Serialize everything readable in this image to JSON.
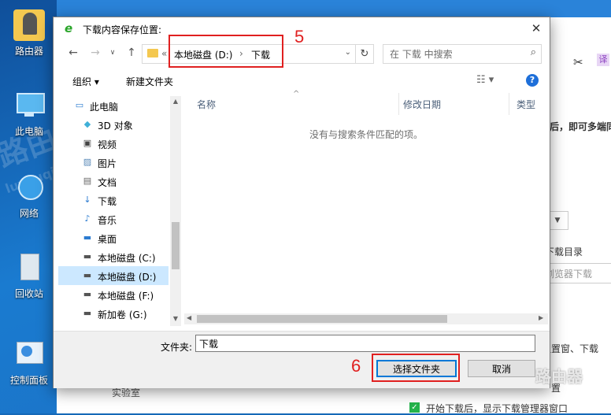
{
  "desktop": {
    "icons": [
      {
        "label": "路由器",
        "icon": "router-folder-icon"
      },
      {
        "label": "此电脑",
        "icon": "computer-icon"
      },
      {
        "label": "网络",
        "icon": "network-icon"
      },
      {
        "label": "回收站",
        "icon": "recycle-bin-icon"
      },
      {
        "label": "控制面板",
        "icon": "control-panel-icon"
      }
    ],
    "watermark_text": "路由器",
    "watermark_sub": "luyouqi.com"
  },
  "background_app": {
    "text_fragments": [
      "后，即可多端同",
      "下载目录",
      "浏览器下载",
      "位置窗、下载",
      "置",
      "开始下载后，显示下载管理器窗口",
      "实验室"
    ],
    "icons": [
      "scissors-icon",
      "translate-icon",
      "checkbox-checked-icon",
      "flask-icon"
    ]
  },
  "dialog": {
    "title": "下载内容保存位置:",
    "title_icon": "browser-e-icon",
    "address": {
      "prefix": "«",
      "segments": [
        "本地磁盘 (D:)",
        "下载"
      ],
      "separator": "›"
    },
    "search_placeholder": "在 下载 中搜索",
    "toolbar": {
      "organize_label": "组织 ▾",
      "new_folder_label": "新建文件夹"
    },
    "tree": [
      {
        "label": "此电脑",
        "icon": "computer-icon",
        "indent": 0,
        "selected": false
      },
      {
        "label": "3D 对象",
        "icon": "3d-objects-icon",
        "indent": 1,
        "selected": false
      },
      {
        "label": "视频",
        "icon": "video-icon",
        "indent": 1,
        "selected": false
      },
      {
        "label": "图片",
        "icon": "pictures-icon",
        "indent": 1,
        "selected": false
      },
      {
        "label": "文档",
        "icon": "documents-icon",
        "indent": 1,
        "selected": false
      },
      {
        "label": "下载",
        "icon": "downloads-icon",
        "indent": 1,
        "selected": false
      },
      {
        "label": "音乐",
        "icon": "music-icon",
        "indent": 1,
        "selected": false
      },
      {
        "label": "桌面",
        "icon": "desktop-icon",
        "indent": 1,
        "selected": false
      },
      {
        "label": "本地磁盘 (C:)",
        "icon": "drive-icon",
        "indent": 1,
        "selected": false
      },
      {
        "label": "本地磁盘 (D:)",
        "icon": "drive-icon",
        "indent": 1,
        "selected": true
      },
      {
        "label": "本地磁盘 (F:)",
        "icon": "drive-icon",
        "indent": 1,
        "selected": false
      },
      {
        "label": "新加卷 (G:)",
        "icon": "drive-icon",
        "indent": 1,
        "selected": false
      }
    ],
    "columns": [
      "名称",
      "修改日期",
      "类型"
    ],
    "empty_message": "没有与搜索条件匹配的项。",
    "folder_label": "文件夹:",
    "folder_value": "下载",
    "select_button": "选择文件夹",
    "cancel_button": "取消"
  },
  "annotations": {
    "step5": "5",
    "step6": "6",
    "color": "#e02020"
  },
  "brand_watermark": "路由器"
}
